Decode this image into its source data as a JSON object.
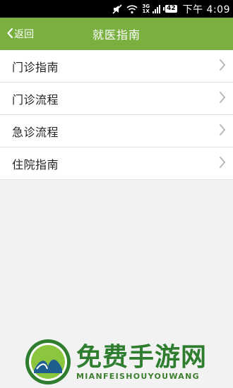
{
  "status_bar": {
    "network_top": "3G",
    "network_bottom": "1X",
    "battery": "42",
    "time": "下午 4:09"
  },
  "header": {
    "back_label": "返回",
    "title": "就医指南"
  },
  "menu": {
    "items": [
      {
        "label": "门诊指南"
      },
      {
        "label": "门诊流程"
      },
      {
        "label": "急诊流程"
      },
      {
        "label": "住院指南"
      }
    ]
  },
  "watermark": {
    "title": "免费手游网",
    "subtitle": "MIANFEISHOUYOUWANG"
  },
  "colors": {
    "accent": "#7ab040",
    "background": "#f2f2f2",
    "watermark_green": "#2f7d2f"
  },
  "icons": [
    "mute-icon",
    "wifi-icon",
    "signal-icon",
    "battery-icon",
    "back-chevron-icon",
    "chevron-right-icon"
  ]
}
